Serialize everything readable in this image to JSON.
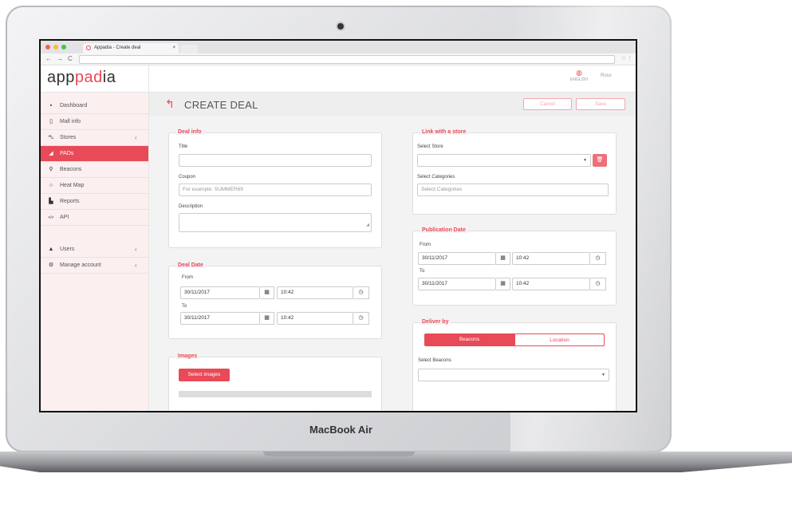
{
  "device": {
    "label": "MacBook Air"
  },
  "browser": {
    "tab_title": "Appadia - Create deal",
    "tab_close": "×",
    "back": "←",
    "forward": "→",
    "reload": "C",
    "star": "☆",
    "menu": "⋮",
    "traffic_colors": [
      "#f25f58",
      "#f9be2e",
      "#3bc942"
    ]
  },
  "app": {
    "logo_parts": [
      "app",
      "pad",
      "ia"
    ],
    "accent_color": "#e84a57",
    "language": {
      "icon": "globe-icon",
      "label": "ENGLISH"
    },
    "user": {
      "name": "Ross"
    }
  },
  "sidebar": {
    "items": [
      {
        "icon": "▪",
        "label": "Dashboard"
      },
      {
        "icon": "▯",
        "label": "Mall info"
      },
      {
        "icon": "⛍",
        "label": "Stores",
        "chevron": "‹"
      },
      {
        "icon": "◢",
        "label": "PADs",
        "active": true
      },
      {
        "icon": "⚲",
        "label": "Beacons"
      },
      {
        "icon": "○",
        "label": "Heat Map"
      },
      {
        "icon": "▙",
        "label": "Reports"
      },
      {
        "icon": "</>",
        "label": "API"
      }
    ],
    "bottom_items": [
      {
        "icon": "👤",
        "label": "Users",
        "chevron": "‹"
      },
      {
        "icon": "⚙",
        "label": "Manage account",
        "chevron": "‹"
      }
    ]
  },
  "page": {
    "title": "CREATE DEAL",
    "cancel_label": "Cancel",
    "save_label": "Save"
  },
  "deal_info": {
    "legend": "Deal info",
    "title_label": "Title",
    "title_value": "",
    "coupon_label": "Coupon",
    "coupon_placeholder": "For example: SUMMER69",
    "description_label": "Description",
    "description_value": ""
  },
  "deal_date": {
    "legend": "Deal Date",
    "from_label": "From",
    "from_date": "30/11/2017",
    "from_time": "10:42",
    "to_label": "To",
    "to_date": "30/11/2017",
    "to_time": "10:42"
  },
  "images": {
    "legend": "Images",
    "button_label": "Select images"
  },
  "link_store": {
    "legend": "Link with a store",
    "store_label": "Select Store",
    "store_value": "",
    "categories_label": "Select Categories",
    "categories_placeholder": "Select Categories"
  },
  "publication_date": {
    "legend": "Publication Date",
    "from_label": "From",
    "from_date": "30/11/2017",
    "from_time": "10:42",
    "to_label": "To",
    "to_date": "30/11/2017",
    "to_time": "10:42"
  },
  "deliver_by": {
    "legend": "Deliver by",
    "option_beacons": "Beacons",
    "option_location": "Location",
    "selected": "Beacons",
    "beacons_label": "Select Beacons",
    "beacons_value": ""
  },
  "icons": {
    "calendar": "▦",
    "clock": "◷",
    "caret": "▼",
    "trash": "🗑",
    "back": "↰",
    "resize": "◢"
  }
}
